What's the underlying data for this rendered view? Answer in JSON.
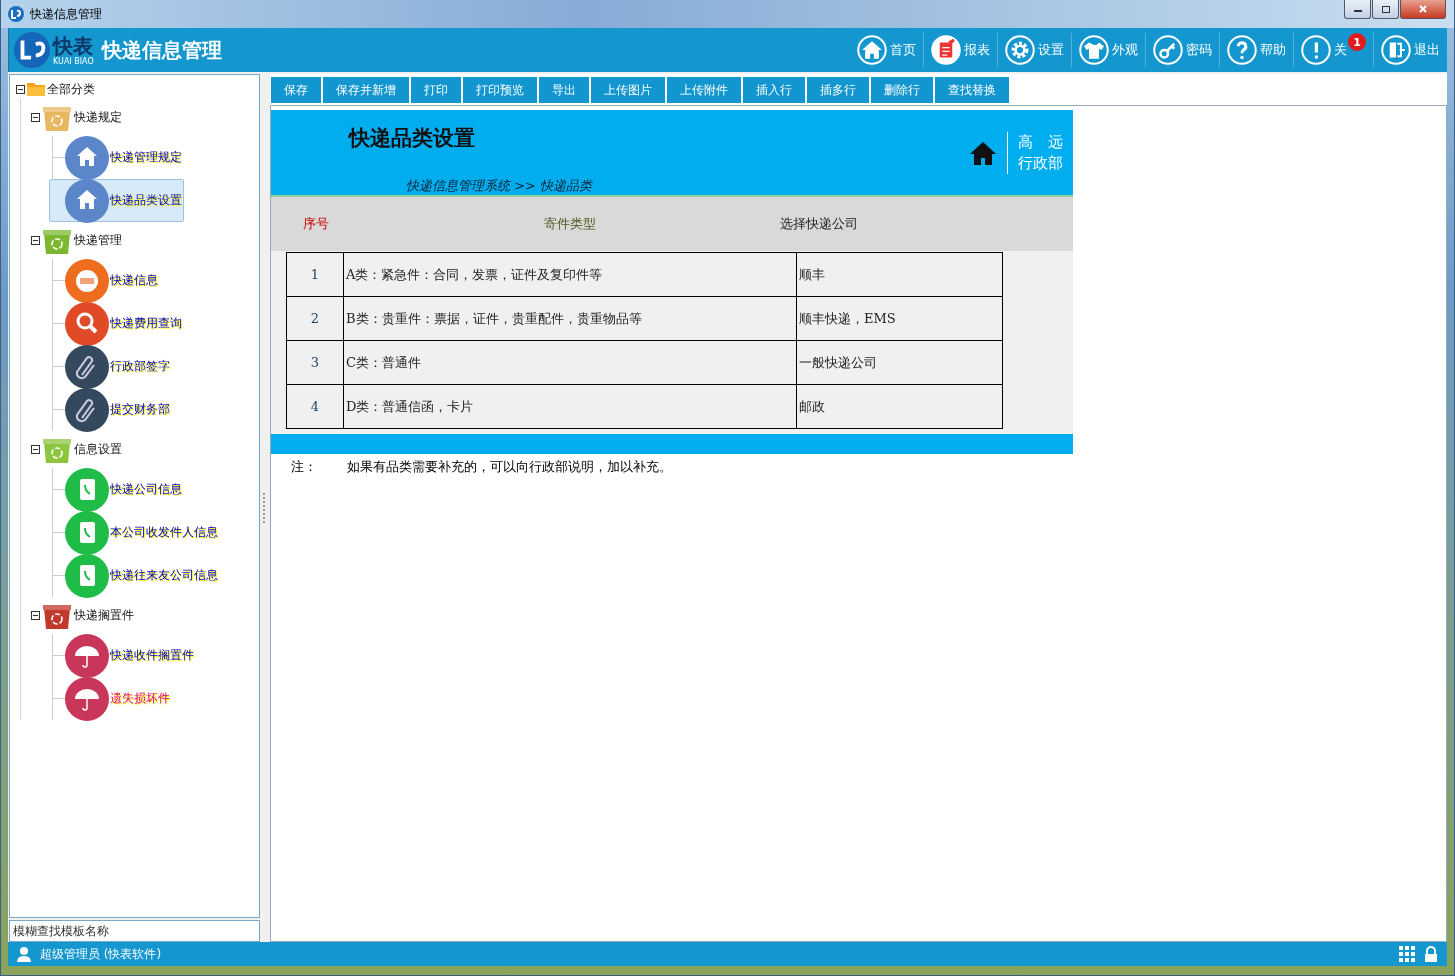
{
  "window": {
    "title": "快递信息管理"
  },
  "header": {
    "logo_text": "快表",
    "logo_sub": "KUAI BIAO",
    "title": "快递信息管理",
    "nav": [
      {
        "label": "首页",
        "kind": "home"
      },
      {
        "label": "报表",
        "kind": "report"
      },
      {
        "label": "设置",
        "kind": "gear"
      },
      {
        "label": "外观",
        "kind": "shirt"
      },
      {
        "label": "密码",
        "kind": "key"
      },
      {
        "label": "帮助",
        "kind": "help"
      },
      {
        "label": "关",
        "kind": "info",
        "badge": "1"
      },
      {
        "label": "退出",
        "kind": "exit"
      }
    ]
  },
  "sidebar": {
    "tree": {
      "label": "全部分类",
      "expanded": true,
      "children": [
        {
          "label": "快递规定",
          "color": "#e8b860",
          "expanded": true,
          "children": [
            {
              "label": "快递管理规定",
              "kind": "house",
              "selected": false,
              "highlighted": false
            },
            {
              "label": "快递品类设置",
              "kind": "house",
              "selected": true,
              "highlighted": false
            }
          ]
        },
        {
          "label": "快递管理",
          "color": "#7cb82f",
          "expanded": true,
          "children": [
            {
              "label": "快递信息",
              "kind": "new",
              "selected": false,
              "highlighted": false
            },
            {
              "label": "快递费用查询",
              "kind": "search",
              "selected": false,
              "highlighted": false
            },
            {
              "label": "行政部签字",
              "kind": "clip",
              "selected": false,
              "highlighted": false
            },
            {
              "label": "提交财务部",
              "kind": "clip",
              "selected": false,
              "highlighted": false
            }
          ]
        },
        {
          "label": "信息设置",
          "color": "#8cc63f",
          "expanded": true,
          "children": [
            {
              "label": "快递公司信息",
              "kind": "phone",
              "selected": false,
              "highlighted": false
            },
            {
              "label": "本公司收发件人信息",
              "kind": "phone",
              "selected": false,
              "highlighted": false
            },
            {
              "label": "快递往来友公司信息",
              "kind": "phone",
              "selected": false,
              "highlighted": false
            }
          ]
        },
        {
          "label": "快递搁置件",
          "color": "#c0392b",
          "expanded": true,
          "children": [
            {
              "label": "快递收件搁置件",
              "kind": "umbrella",
              "selected": false,
              "highlighted": false
            },
            {
              "label": "遗失损坏件",
              "kind": "umbrella",
              "selected": false,
              "highlighted": true
            }
          ]
        }
      ]
    },
    "search": {
      "placeholder": "模糊查找模板名称"
    }
  },
  "toolbar": [
    "保存",
    "保存并新增",
    "打印",
    "打印预览",
    "导出",
    "上传图片",
    "上传附件",
    "插入行",
    "插多行",
    "删除行",
    "查找替换"
  ],
  "form": {
    "title": "快递品类设置",
    "breadcrumb": "快递信息管理系统 >> 快递品类",
    "user": "高　远",
    "department": "行政部",
    "columns": [
      "序号",
      "寄件类型",
      "选择快递公司"
    ],
    "rows": [
      [
        "1",
        "A类：紧急件：合同，发票，证件及复印件等",
        "顺丰"
      ],
      [
        "2",
        "B类：贵重件：票据，证件，贵重配件，贵重物品等",
        "顺丰快递，EMS"
      ],
      [
        "3",
        "C类：普通件",
        "一般快递公司"
      ],
      [
        "4",
        "D类：普通信函，卡片",
        "邮政"
      ]
    ],
    "note_label": "注：",
    "note": "如果有品类需要补充的，可以向行政部说明，加以补充。"
  },
  "status_bar": {
    "user": "超级管理员 (快表软件)"
  }
}
